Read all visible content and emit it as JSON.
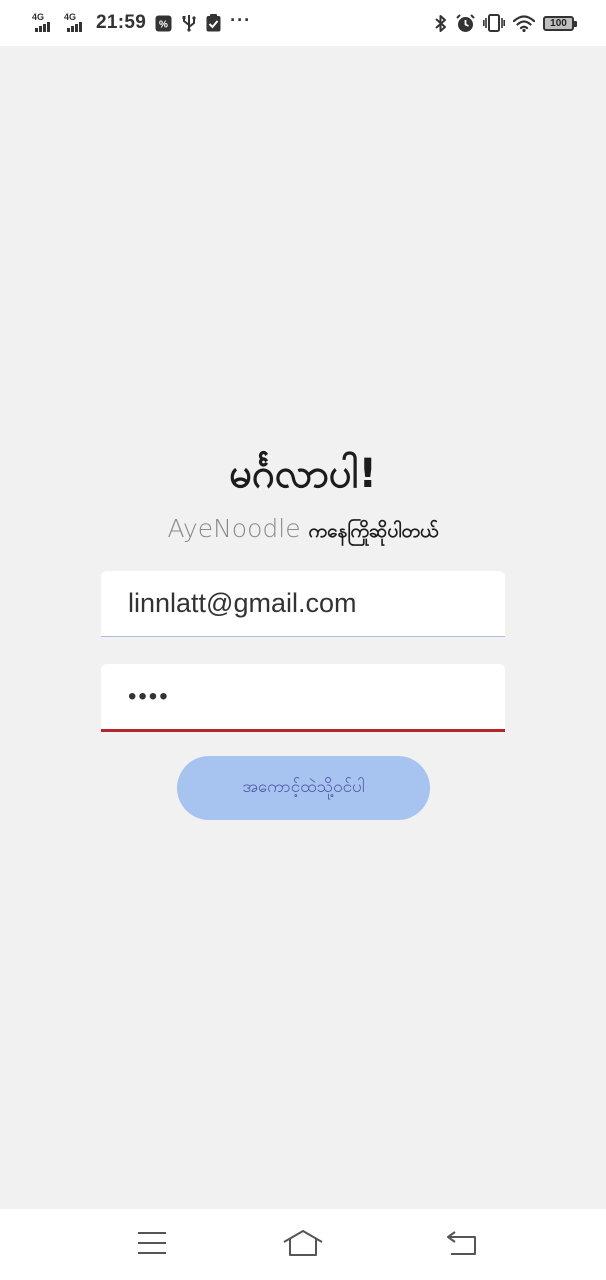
{
  "status_bar": {
    "network_1": "4G",
    "network_2": "4G",
    "time": "21:59",
    "battery": "100",
    "left_icons": [
      "signal-icon",
      "signal-icon",
      "app-notification-icon",
      "usb-icon",
      "task-check-icon",
      "more-icon"
    ],
    "right_icons": [
      "bluetooth-icon",
      "alarm-icon",
      "vibrate-icon",
      "wifi-icon",
      "battery-icon"
    ]
  },
  "login": {
    "greeting": "မင်္ဂလာပါ!",
    "brand": "AyeNoodle",
    "welcome": "ကနေကြိုဆိုပါတယ်",
    "email_value": "linnlatt@gmail.com",
    "password_value": "••••",
    "button_label": "အကောင့်ထဲသို့ဝင်ပါ"
  },
  "colors": {
    "background": "#f1f1f1",
    "button_bg": "#a7c3ef",
    "button_text": "#4f57a8",
    "password_underline": "#b3262a",
    "email_underline": "#a9bde0"
  },
  "nav_bar": {
    "icons": [
      "menu-icon",
      "home-icon",
      "back-icon"
    ]
  }
}
